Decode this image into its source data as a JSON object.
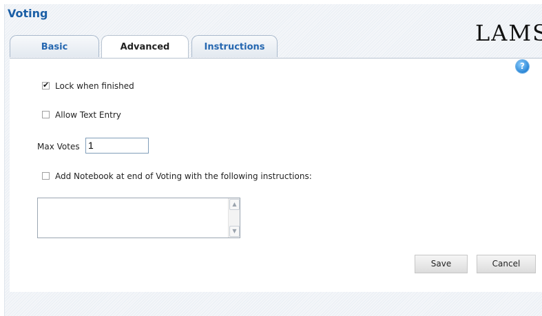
{
  "app": {
    "title": "Voting",
    "logo_text": "LAMS"
  },
  "tabs": [
    {
      "label": "Basic",
      "active": false
    },
    {
      "label": "Advanced",
      "active": true
    },
    {
      "label": "Instructions",
      "active": false
    }
  ],
  "help": {
    "icon": "help-icon",
    "glyph": "?"
  },
  "advanced": {
    "lock_when_finished": {
      "label": "Lock when finished",
      "checked": true
    },
    "allow_text_entry": {
      "label": "Allow Text Entry",
      "checked": false
    },
    "max_votes": {
      "label": "Max Votes",
      "value": "1"
    },
    "add_notebook": {
      "label": "Add Notebook at end of Voting with the following instructions:",
      "checked": false
    },
    "notebook_instructions": {
      "value": ""
    }
  },
  "actions": {
    "save_label": "Save",
    "cancel_label": "Cancel"
  },
  "colors": {
    "title": "#1b5fa6",
    "tab_text": "#2567b0",
    "help_icon": "#2a86d6"
  }
}
